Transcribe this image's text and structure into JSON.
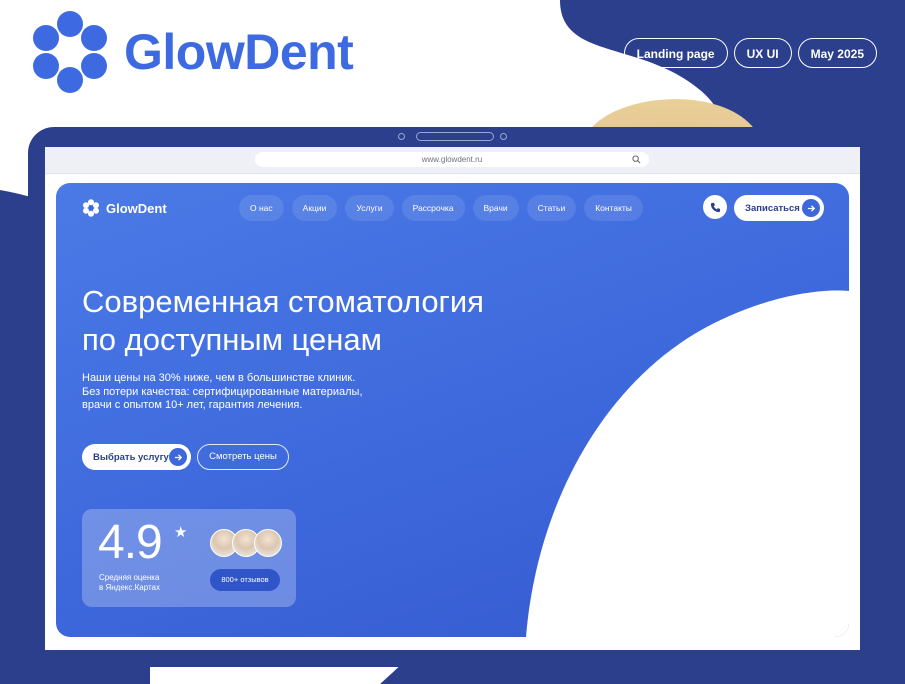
{
  "brand": {
    "name": "GlowDent"
  },
  "tags": [
    "Landing page",
    "UX UI",
    "May 2025"
  ],
  "browser": {
    "url": "www.glowdent.ru"
  },
  "site": {
    "logo_name": "GlowDent",
    "nav": [
      "О нас",
      "Акции",
      "Услуги",
      "Рассрочка",
      "Врачи",
      "Статьи",
      "Контакты"
    ],
    "book_label": "Записаться"
  },
  "hero": {
    "headline_line1": "Современная стоматология",
    "headline_line2": "по доступным ценам",
    "sub_line1": "Наши цены на 30% ниже, чем в большинстве клиник.",
    "sub_line2": "Без потери качества: сертифицированные материалы,",
    "sub_line3": "врачи с опытом 10+ лет, гарантия лечения.",
    "cta_primary": "Выбрать услугу",
    "cta_secondary": "Смотреть цены"
  },
  "rating": {
    "value": "4.9",
    "star": "★",
    "caption_line1": "Средняя оценка",
    "caption_line2": "в Яндекс.Картах",
    "reviews": "800+ отзывов"
  },
  "colors": {
    "brand_blue": "#3d6ae0",
    "navy": "#2b3f8d",
    "hero_blue": "#3d68dc"
  },
  "icons": [
    "flower-logo-icon",
    "search-icon",
    "phone-icon",
    "arrow-right-icon",
    "star-icon"
  ]
}
